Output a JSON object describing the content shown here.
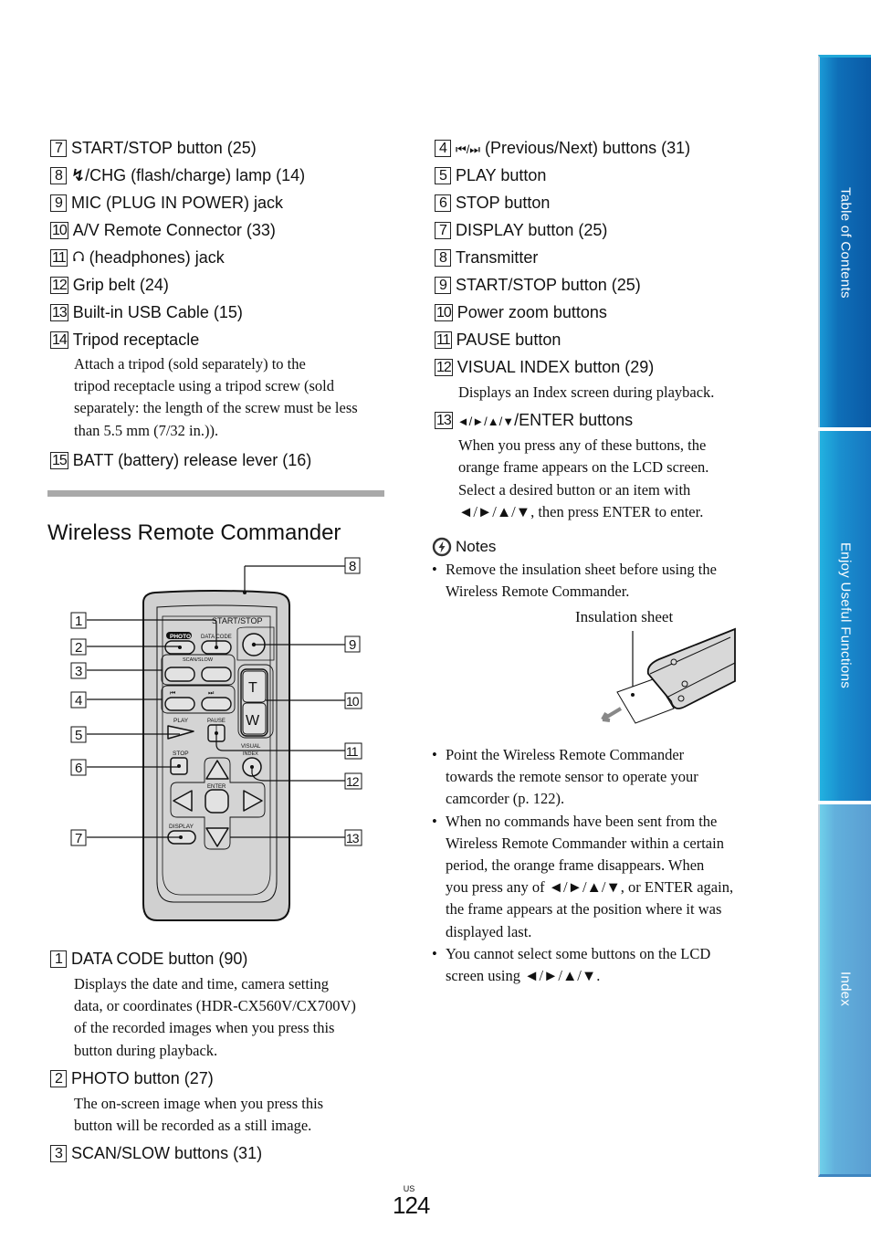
{
  "left_top_list": [
    {
      "num": "7",
      "label": "START/STOP button (25)"
    },
    {
      "num": "8",
      "icon": "flash-icon",
      "label": "/CHG (flash/charge) lamp (14)"
    },
    {
      "num": "9",
      "label": "MIC (PLUG IN POWER) jack"
    },
    {
      "num": "10",
      "label": "A/V Remote Connector (33)"
    },
    {
      "num": "11",
      "icon": "headphones-icon",
      "label": " (headphones) jack"
    },
    {
      "num": "12",
      "label": "Grip belt (24)"
    },
    {
      "num": "13",
      "label": "Built-in USB Cable (15)"
    },
    {
      "num": "14",
      "label": "Tripod receptacle",
      "desc": [
        "Attach a tripod (sold separately) to the",
        "tripod receptacle using a tripod screw (sold",
        "separately: the length of the screw must be less",
        "than 5.5 mm (7/32 in.))."
      ]
    },
    {
      "num": "15",
      "label": "BATT (battery) release lever (16)"
    }
  ],
  "section_title": "Wireless Remote Commander",
  "diagram": {
    "callouts": [
      "1",
      "2",
      "3",
      "4",
      "5",
      "6",
      "7",
      "8",
      "9",
      "10",
      "11",
      "12",
      "13"
    ],
    "remote_labels": {
      "start_stop": "START/STOP",
      "photo": "PHOTO",
      "data_code": "DATA CODE",
      "scan_slow": "SCAN/SLOW",
      "play": "PLAY",
      "pause": "PAUSE",
      "stop": "STOP",
      "visual": "VISUAL",
      "index": "INDEX",
      "enter": "ENTER",
      "display": "DISPLAY",
      "zoom_t": "T",
      "zoom_w": "W"
    }
  },
  "left_bottom_list": [
    {
      "num": "1",
      "label": "DATA CODE button (90)",
      "desc": [
        "Displays the date and time, camera setting",
        "data, or coordinates (HDR-CX560V/CX700V)",
        "of the recorded images when you press this",
        "button during playback."
      ]
    },
    {
      "num": "2",
      "label": "PHOTO button (27)",
      "desc": [
        "The on-screen image when you press this",
        "button will be recorded as a still image."
      ]
    },
    {
      "num": "3",
      "label": "SCAN/SLOW buttons (31)"
    }
  ],
  "right_list": [
    {
      "num": "4",
      "prefix": "⏮/⏭",
      "label": " (Previous/Next) buttons (31)"
    },
    {
      "num": "5",
      "label": "PLAY button"
    },
    {
      "num": "6",
      "label": "STOP button"
    },
    {
      "num": "7",
      "label": "DISPLAY button (25)"
    },
    {
      "num": "8",
      "label": "Transmitter"
    },
    {
      "num": "9",
      "label": "START/STOP button (25)"
    },
    {
      "num": "10",
      "label": "Power zoom buttons"
    },
    {
      "num": "11",
      "label": "PAUSE button"
    },
    {
      "num": "12",
      "label": "VISUAL INDEX button (29)",
      "desc": [
        "Displays an Index screen during playback."
      ]
    },
    {
      "num": "13",
      "prefix": "◄/►/▲/▼",
      "label": "/ENTER buttons",
      "desc": [
        "When you press any of these buttons, the",
        "orange frame appears on the LCD screen.",
        "Select a desired button or an item with",
        "◄/►/▲/▼, then press ENTER to enter."
      ]
    }
  ],
  "notes": {
    "title": "Notes",
    "first": [
      "Remove the insulation sheet before using the",
      "Wireless Remote Commander."
    ],
    "figure_label": "Insulation sheet",
    "rest": [
      [
        "Point the Wireless Remote Commander",
        "towards the remote sensor to operate your",
        "camcorder (p. 122)."
      ],
      [
        "When no commands have been sent from the",
        "Wireless Remote Commander within a certain",
        "period, the orange frame disappears. When",
        "you press any of ◄/►/▲/▼, or ENTER again,",
        "the frame appears at the position where it was",
        "displayed last."
      ],
      [
        "You cannot select some buttons on the LCD",
        "screen using ◄/►/▲/▼."
      ]
    ]
  },
  "sidebar": {
    "tabs": [
      {
        "label": "Table of Contents",
        "color": "#0f6fb8"
      },
      {
        "label": "Enjoy Useful Functions",
        "color": "#1a8fcf"
      },
      {
        "label": "Index",
        "color": "#62b0dc"
      }
    ]
  },
  "footer": {
    "region": "US",
    "page_number": "124"
  }
}
